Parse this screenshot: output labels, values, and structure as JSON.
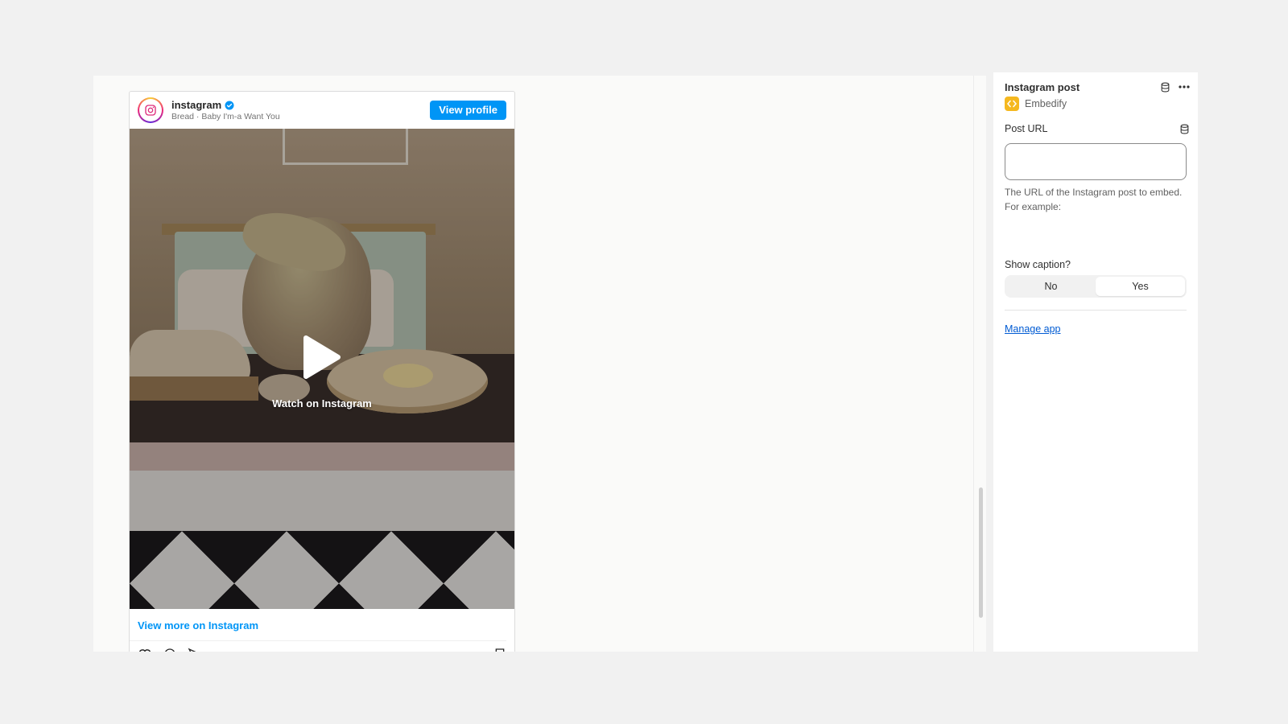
{
  "embed": {
    "username": "instagram",
    "subtitle": "Bread · Baby I'm-a Want You",
    "view_profile_label": "View profile",
    "watch_label": "Watch on Instagram",
    "view_more_label": "View more on Instagram"
  },
  "sidebar": {
    "title": "Instagram post",
    "app_name": "Embedify",
    "post_url": {
      "label": "Post URL",
      "value": "",
      "help_text": "The URL of the Instagram post to embed. For example:"
    },
    "show_caption": {
      "label": "Show caption?",
      "options": [
        "No",
        "Yes"
      ],
      "selected": "Yes"
    },
    "manage_app_label": "Manage app"
  },
  "colors": {
    "instagram_blue": "#0095f6",
    "app_accent": "#f5b81f",
    "link": "#005bd3"
  },
  "icons": {
    "verified": "verified-badge-icon",
    "play": "play-icon",
    "database": "database-icon",
    "more": "more-horizontal-icon",
    "app_logo": "code-brackets-icon"
  }
}
